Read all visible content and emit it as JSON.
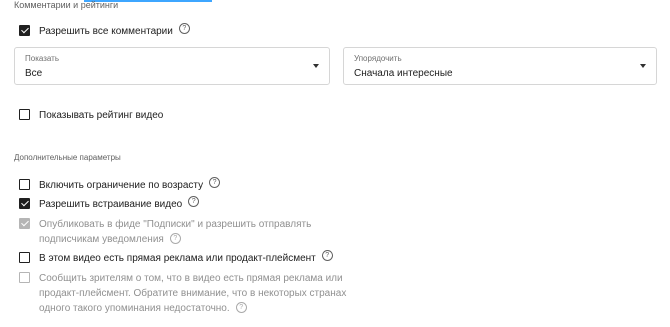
{
  "section_title": "Комментарии и рейтинги",
  "allow_comments": {
    "label": "Разрешить все комментарии",
    "checked": true
  },
  "show_select": {
    "label": "Показать",
    "value": "Все"
  },
  "sort_select": {
    "label": "Упорядочить",
    "value": "Сначала интересные"
  },
  "show_rating": {
    "label": "Показывать рейтинг видео",
    "checked": false
  },
  "additional_params_title": "Дополнительные параметры",
  "options": {
    "age_restriction": {
      "label": "Включить ограничение по возрасту",
      "checked": false
    },
    "allow_embedding": {
      "label": "Разрешить встраивание видео",
      "checked": true
    },
    "publish_to_subscriptions": {
      "line1": "Опубликовать в фиде \"Подписки\" и разрешить отправлять",
      "line2": "подписчикам уведомления",
      "checked": true,
      "disabled": true
    },
    "paid_promotion": {
      "label": "В этом видео есть прямая реклама или продакт-плейсмент",
      "checked": false
    },
    "notify_viewers": {
      "line1": "Сообщить зрителям о том, что в видео есть прямая реклама или",
      "line2": "продакт-плейсмент. Обратите внимание, что в некоторых странах",
      "line3": "одного такого упоминания недостаточно.",
      "checked": false,
      "disabled": true
    }
  },
  "help_glyph": "?",
  "colors": {
    "accent": "#3ea6ff",
    "text": "#202020",
    "disabled": "#909090"
  }
}
